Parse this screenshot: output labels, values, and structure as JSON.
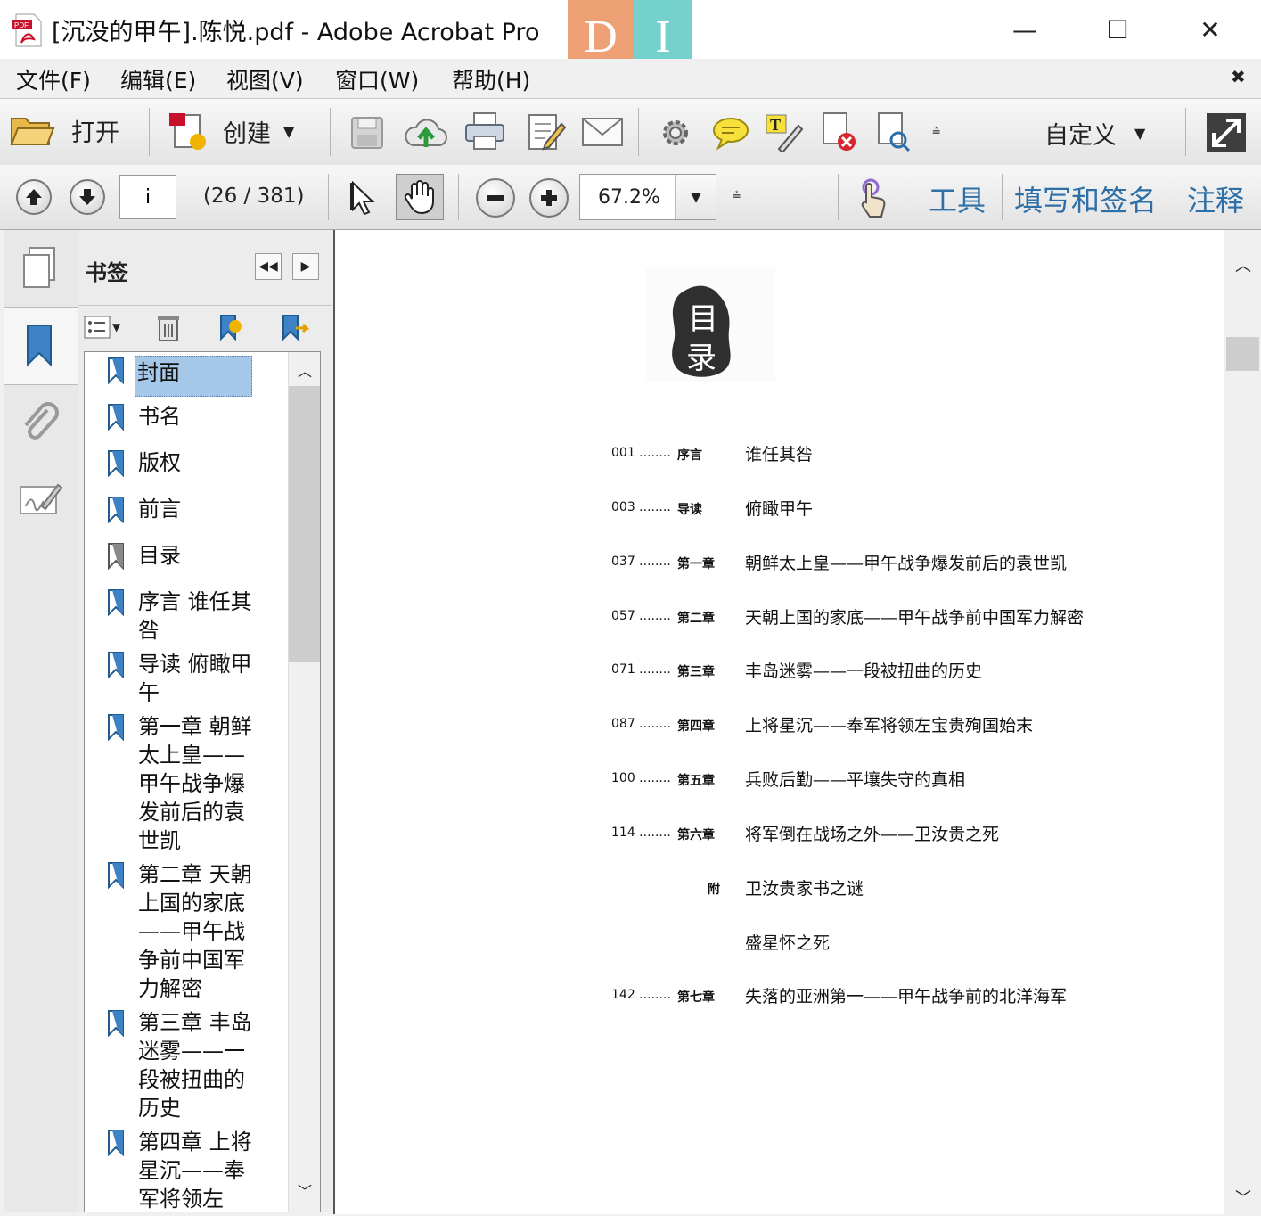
{
  "window": {
    "title": "[沉没的甲午].陈悦.pdf - Adobe Acrobat Pro",
    "minimize": "—",
    "maximize": "☐",
    "close": "✕"
  },
  "menu": {
    "items": [
      "文件(F)",
      "编辑(E)",
      "视图(V)",
      "窗口(W)",
      "帮助(H)"
    ],
    "close_doc": "✖"
  },
  "toolbar": {
    "open_label": "打开",
    "create_label": "创建",
    "customize_label": "自定义"
  },
  "nav": {
    "page_input": "i",
    "page_count": "(26 / 381)",
    "zoom": "67.2%",
    "tools_label": "工具",
    "fill_sign_label": "填写和签名",
    "comment_label": "注释"
  },
  "bookmarks": {
    "panel_title": "书签",
    "items": [
      {
        "label": "封面",
        "selected": true
      },
      {
        "label": "书名"
      },
      {
        "label": "版权"
      },
      {
        "label": "前言"
      },
      {
        "label": "目录",
        "current": true
      },
      {
        "label": "序言  谁任其咎"
      },
      {
        "label": "导读  俯瞰甲午"
      },
      {
        "label": "第一章  朝鲜太上皇——甲午战争爆发前后的袁世凯"
      },
      {
        "label": "第二章  天朝上国的家底——甲午战争前中国军力解密"
      },
      {
        "label": "第三章  丰岛迷雾——一段被扭曲的历史"
      },
      {
        "label": "第四章  上将星沉——奉军将领左"
      }
    ]
  },
  "document": {
    "stamp_line1": "目",
    "stamp_line2": "录",
    "toc": [
      {
        "num": "001 ........",
        "chapter": "序言",
        "title": "谁任其咎"
      },
      {
        "num": "003 ........",
        "chapter": "导读",
        "title": "俯瞰甲午"
      },
      {
        "num": "037 ........",
        "chapter": "第一章",
        "title": "朝鲜太上皇——甲午战争爆发前后的袁世凯"
      },
      {
        "num": "057 ........",
        "chapter": "第二章",
        "title": "天朝上国的家底——甲午战争前中国军力解密"
      },
      {
        "num": "071 ........",
        "chapter": "第三章",
        "title": "丰岛迷雾——一段被扭曲的历史"
      },
      {
        "num": "087 ........",
        "chapter": "第四章",
        "title": "上将星沉——奉军将领左宝贵殉国始末"
      },
      {
        "num": "100 ........",
        "chapter": "第五章",
        "title": "兵败后勤——平壤失守的真相"
      },
      {
        "num": "114 ........",
        "chapter": "第六章",
        "title": "将军倒在战场之外——卫汝贵之死"
      },
      {
        "num": "",
        "chapter": "附",
        "title": "卫汝贵家书之谜"
      },
      {
        "num": "",
        "chapter": "",
        "title": "盛星怀之死"
      },
      {
        "num": "142 ........",
        "chapter": "第七章",
        "title": "失落的亚洲第一——甲午战争前的北洋海军"
      }
    ]
  },
  "colors": {
    "accent": "#2d6fa6",
    "selection": "#a6c8e8",
    "overlay_orange": "#e07a3a",
    "overlay_teal": "#3bbcb4"
  }
}
